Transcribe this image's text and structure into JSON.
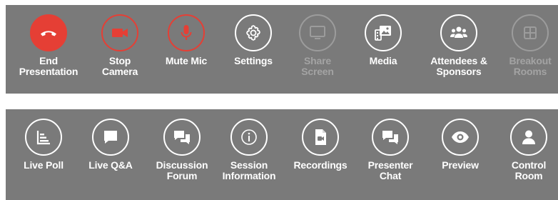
{
  "colors": {
    "bar_background": "#7a7a7a",
    "accent_red": "#e53f35",
    "icon_white": "#ffffff",
    "disabled": "#9c9c9c"
  },
  "top_toolbar": {
    "buttons": [
      {
        "line1": "End",
        "line2": "Presentation",
        "icon": "phone-hangup-icon",
        "enabled": true
      },
      {
        "line1": "Stop",
        "line2": "Camera",
        "icon": "video-camera-icon",
        "enabled": true
      },
      {
        "line1": "Mute Mic",
        "line2": "",
        "icon": "microphone-icon",
        "enabled": true
      },
      {
        "line1": "Settings",
        "line2": "",
        "icon": "gear-icon",
        "enabled": true
      },
      {
        "line1": "Share",
        "line2": "Screen",
        "icon": "monitor-icon",
        "enabled": false
      },
      {
        "line1": "Media",
        "line2": "",
        "icon": "media-icon",
        "enabled": true
      },
      {
        "line1": "Attendees &",
        "line2": "Sponsors",
        "icon": "people-group-icon",
        "enabled": true
      },
      {
        "line1": "Breakout",
        "line2": "Rooms",
        "icon": "grid-icon",
        "enabled": false
      }
    ]
  },
  "bottom_toolbar": {
    "buttons": [
      {
        "line1": "Live Poll",
        "line2": "",
        "icon": "poll-chart-icon",
        "enabled": true
      },
      {
        "line1": "Live Q&A",
        "line2": "",
        "icon": "speech-bubble-icon",
        "enabled": true
      },
      {
        "line1": "Discussion",
        "line2": "Forum",
        "icon": "chat-bubbles-icon",
        "enabled": true
      },
      {
        "line1": "Session",
        "line2": "Information",
        "icon": "info-icon",
        "enabled": true
      },
      {
        "line1": "Recordings",
        "line2": "",
        "icon": "recording-file-icon",
        "enabled": true
      },
      {
        "line1": "Presenter",
        "line2": "Chat",
        "icon": "chat-bubbles-icon",
        "enabled": true
      },
      {
        "line1": "Preview",
        "line2": "",
        "icon": "eye-icon",
        "enabled": true
      },
      {
        "line1": "Control",
        "line2": "Room",
        "icon": "user-icon",
        "enabled": true
      }
    ]
  }
}
